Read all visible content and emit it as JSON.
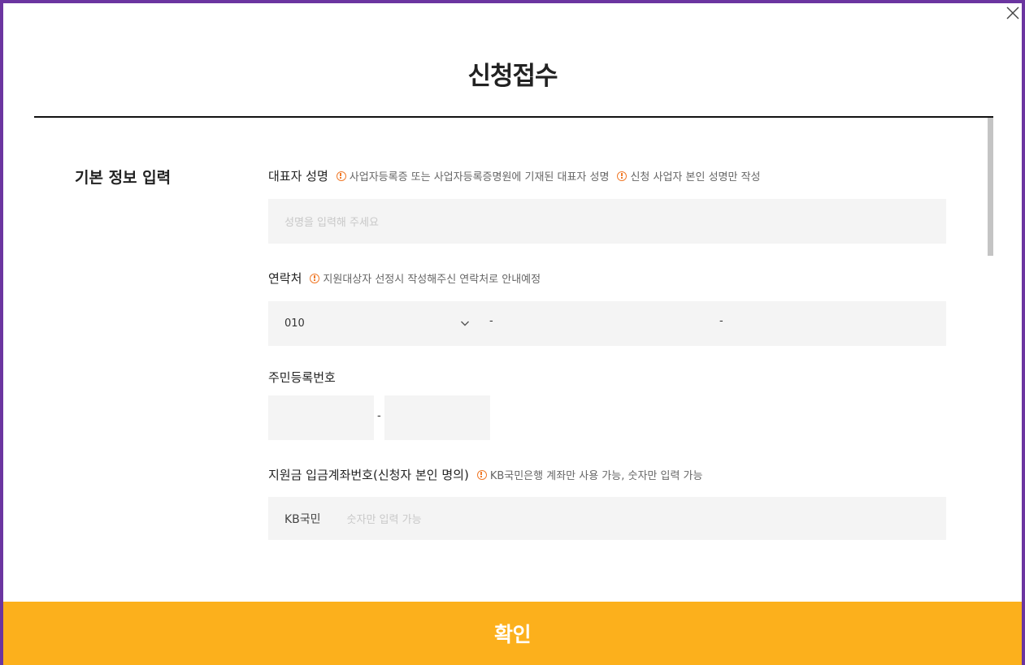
{
  "modal": {
    "title": "신청접수",
    "close_icon": "close-icon"
  },
  "section": {
    "title": "기본 정보 입력"
  },
  "fields": {
    "name": {
      "label": "대표자 성명",
      "hints": [
        "사업자등록증 또는 사업자등록증명원에 기재된 대표자 성명",
        "신청 사업자 본인 성명만 작성"
      ],
      "placeholder": "성명을 입력해 주세요",
      "value": ""
    },
    "phone": {
      "label": "연락처",
      "hint": "지원대상자 선정시 작성해주신 연락처로 안내예정",
      "prefix": "010",
      "separator": "-",
      "middle": "",
      "last": ""
    },
    "ssn": {
      "label": "주민등록번호",
      "separator": "-",
      "front": "",
      "back": ""
    },
    "account": {
      "label": "지원금 입금계좌번호(신청자 본인 명의)",
      "hint": "KB국민은행 계좌만 사용 가능, 숫자만 입력 가능",
      "bank": "KB국민",
      "placeholder": "숫자만 입력 가능",
      "value": ""
    }
  },
  "actions": {
    "confirm_label": "확인"
  },
  "colors": {
    "frame_border": "#6b35a0",
    "accent": "#fcb01c",
    "hint_icon": "#f07a2a",
    "input_bg": "#f4f4f4"
  }
}
